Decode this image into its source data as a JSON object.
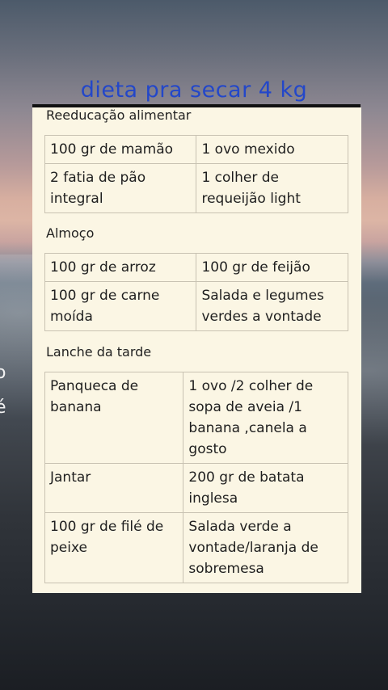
{
  "title": "dieta pra secar 4 kg",
  "overlay_fragments": [
    "o",
    "é"
  ],
  "sections": [
    {
      "label": "Reeducação alimentar",
      "rows": [
        [
          "100 gr de mamão",
          "1 ovo mexido"
        ],
        [
          "2 fatia de pão integral",
          "1 colher de requeijão light"
        ]
      ]
    },
    {
      "label": "Almoço",
      "rows": [
        [
          "100 gr de arroz",
          "100 gr de feijão"
        ],
        [
          "100 gr de carne moída",
          "Salada e legumes verdes a vontade"
        ]
      ]
    },
    {
      "label": "Lanche da tarde",
      "rows": [
        [
          "Panqueca de banana",
          "1 ovo /2 colher de sopa de aveia /1 banana ,canela a gosto"
        ],
        [
          "Jantar",
          "200 gr de batata inglesa"
        ],
        [
          "100 gr de filé de peixe",
          "Salada verde a vontade/laranja de sobremesa"
        ]
      ]
    }
  ]
}
